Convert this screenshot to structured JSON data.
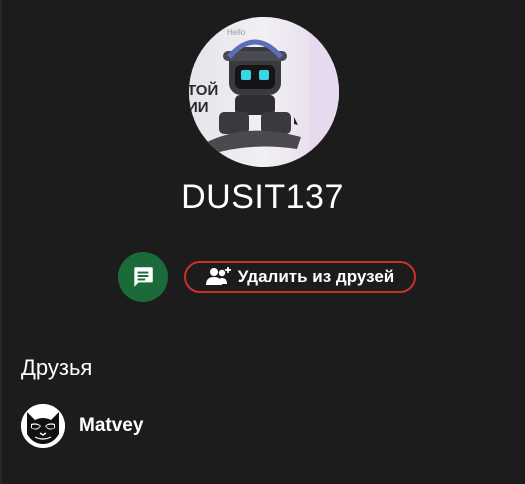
{
  "profile": {
    "username": "DUSIT137",
    "avatar_icon": "robot-avatar",
    "avatar_text_hello": "Hello",
    "avatar_text_side": "ТОЙ\nИИ"
  },
  "actions": {
    "chat_icon": "message-icon",
    "unfriend_icon": "user-remove-icon",
    "unfriend_label": "Удалить из друзей"
  },
  "friends": {
    "heading": "Друзья",
    "items": [
      {
        "name": "Matvey",
        "avatar_icon": "cat-sunglasses-avatar"
      }
    ]
  },
  "colors": {
    "background": "#1c1c1c",
    "chat_button": "#1b6b3a",
    "unfriend_border": "#c8322c"
  }
}
